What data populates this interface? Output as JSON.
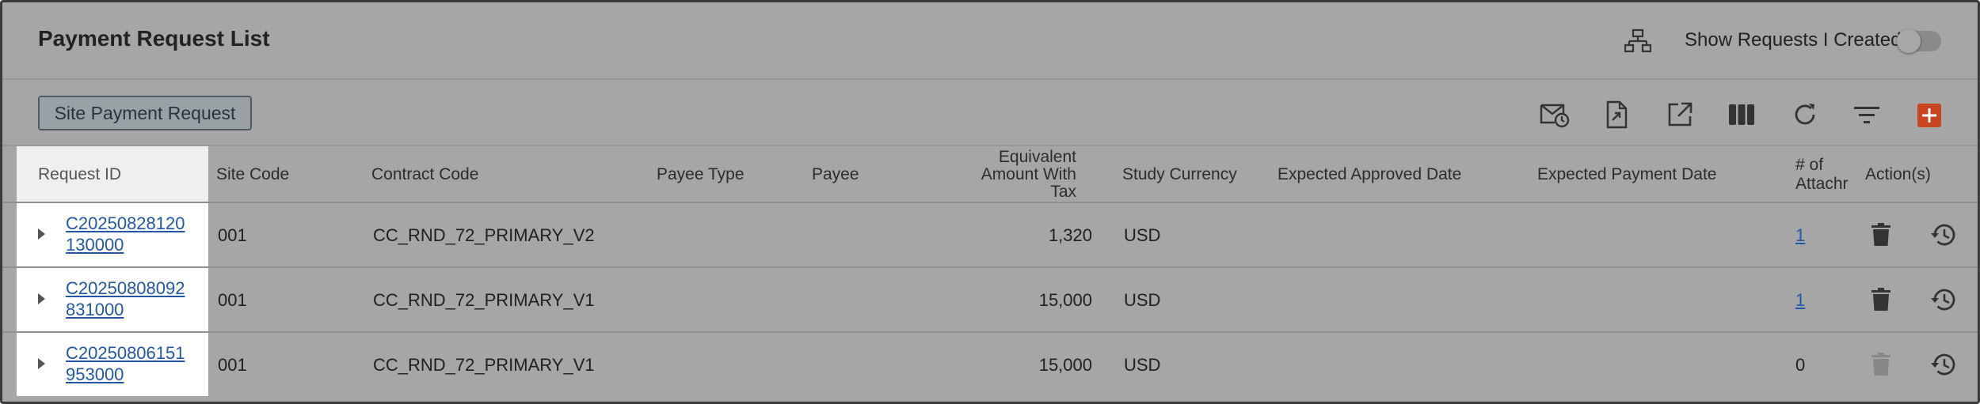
{
  "header": {
    "title": "Payment Request List",
    "hierarchy_icon": "hierarchy-icon",
    "toggle_label": "Show Requests I Created",
    "toggle_state": "off"
  },
  "toolbar": {
    "site_payment_request_label": "Site Payment Request",
    "icons": [
      "scheduled-mail-icon",
      "export-file-icon",
      "open-external-icon",
      "columns-icon",
      "refresh-icon",
      "filter-icon",
      "add-icon"
    ],
    "accent_color": "#c8451f"
  },
  "table": {
    "columns": {
      "request_id": "Request ID",
      "site_code": "Site Code",
      "contract_code": "Contract Code",
      "payee_type": "Payee Type",
      "payee": "Payee",
      "equiv_line1": "Equivalent",
      "equiv_line2": "Amount With",
      "equiv_line3": "Tax",
      "study_currency": "Study Currency",
      "expected_approved_date": "Expected Approved Date",
      "expected_payment_date": "Expected Payment Date",
      "attach_line1": "# of",
      "attach_line2": "Attachr",
      "actions": "Action(s)"
    },
    "rows": [
      {
        "request_id": "C20250828120130000",
        "site_code": "001",
        "contract_code": "CC_RND_72_PRIMARY_V2",
        "payee_type": "",
        "payee": "",
        "amount": "1,320",
        "currency": "USD",
        "approved_date": "",
        "payment_date": "",
        "attachments": "1",
        "delete_enabled": true
      },
      {
        "request_id": "C20250808092831000",
        "site_code": "001",
        "contract_code": "CC_RND_72_PRIMARY_V1",
        "payee_type": "",
        "payee": "",
        "amount": "15,000",
        "currency": "USD",
        "approved_date": "",
        "payment_date": "",
        "attachments": "1",
        "delete_enabled": true
      },
      {
        "request_id": "C20250806151953000",
        "site_code": "001",
        "contract_code": "CC_RND_72_PRIMARY_V1",
        "payee_type": "",
        "payee": "",
        "amount": "15,000",
        "currency": "USD",
        "approved_date": "",
        "payment_date": "",
        "attachments": "0",
        "delete_enabled": false
      }
    ]
  }
}
